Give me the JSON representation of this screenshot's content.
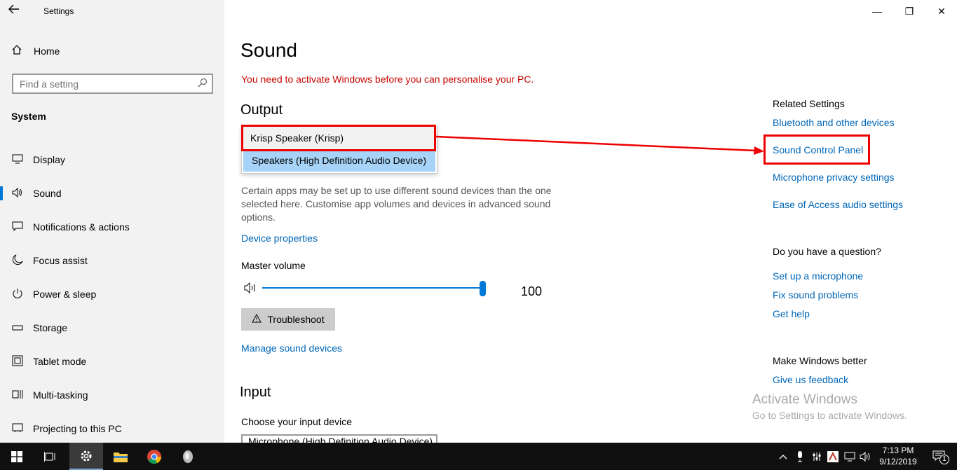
{
  "window": {
    "title": "Settings",
    "minimize": "—",
    "maximize": "❐",
    "close": "✕"
  },
  "sidebar": {
    "home_label": "Home",
    "search_placeholder": "Find a setting",
    "section": "System",
    "items": [
      {
        "label": "Display",
        "icon": "▭"
      },
      {
        "label": "Sound",
        "icon": "🔊"
      },
      {
        "label": "Notifications & actions",
        "icon": "▢"
      },
      {
        "label": "Focus assist",
        "icon": "☾"
      },
      {
        "label": "Power & sleep",
        "icon": "⏻"
      },
      {
        "label": "Storage",
        "icon": "▬"
      },
      {
        "label": "Tablet mode",
        "icon": "▣"
      },
      {
        "label": "Multi-tasking",
        "icon": "▤"
      },
      {
        "label": "Projecting to this PC",
        "icon": "▭"
      }
    ]
  },
  "main": {
    "title": "Sound",
    "activation_warning": "You need to activate Windows before you can personalise your PC.",
    "output_heading": "Output",
    "output_devices": [
      "Krisp Speaker (Krisp)",
      "Speakers (High Definition Audio Device)"
    ],
    "output_desc": "Certain apps may be set up to use different sound devices than the one selected here. Customise app volumes and devices in advanced sound options.",
    "device_properties": "Device properties",
    "master_volume_label": "Master volume",
    "master_volume_value": "100",
    "troubleshoot_label": "Troubleshoot",
    "manage_devices": "Manage sound devices",
    "input_heading": "Input",
    "input_device_label": "Choose your input device",
    "input_device_value": "Microphone (High Definition Audio Device)"
  },
  "related": {
    "heading": "Related Settings",
    "links": [
      "Bluetooth and other devices",
      "Sound Control Panel",
      "Microphone privacy settings",
      "Ease of Access audio settings"
    ],
    "question_heading": "Do you have a question?",
    "help_links": [
      "Set up a microphone",
      "Fix sound problems",
      "Get help"
    ],
    "better_heading": "Make Windows better",
    "feedback_link": "Give us feedback"
  },
  "watermark": {
    "line1": "Activate Windows",
    "line2": "Go to Settings to activate Windows."
  },
  "taskbar": {
    "time": "7:13 PM",
    "date": "9/12/2019",
    "notification_count": "1",
    "accent": "#0078d7"
  }
}
